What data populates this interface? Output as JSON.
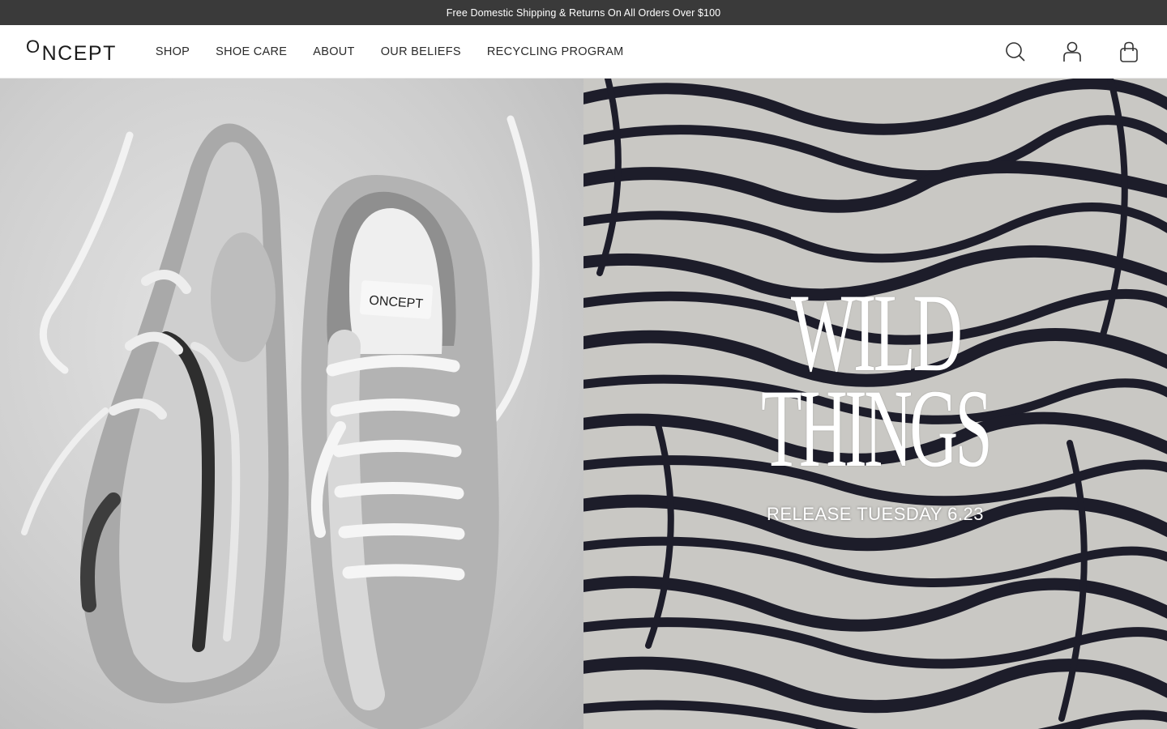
{
  "announcement": "Free Domestic Shipping & Returns On All Orders Over $100",
  "brand": {
    "logo_initial": "O",
    "logo_rest": "NCEPT"
  },
  "nav": [
    {
      "label": "SHOP"
    },
    {
      "label": "SHOE CARE"
    },
    {
      "label": "ABOUT"
    },
    {
      "label": "OUR BELIEFS"
    },
    {
      "label": "RECYCLING PROGRAM"
    }
  ],
  "header_icons": [
    "search-icon",
    "account-icon",
    "cart-icon"
  ],
  "hero": {
    "left_image_label": "Silver metallic sneakers with white laces",
    "shoe_tag_text": "ONCEPT",
    "headline_line1": "WILD",
    "headline_line2": "THINGS",
    "release": "RELEASE TUESDAY 6.23"
  },
  "colors": {
    "announcement_bg": "#3a3a3a",
    "zebra_dark": "#1d1d2a",
    "zebra_light": "#c9c8c4"
  }
}
